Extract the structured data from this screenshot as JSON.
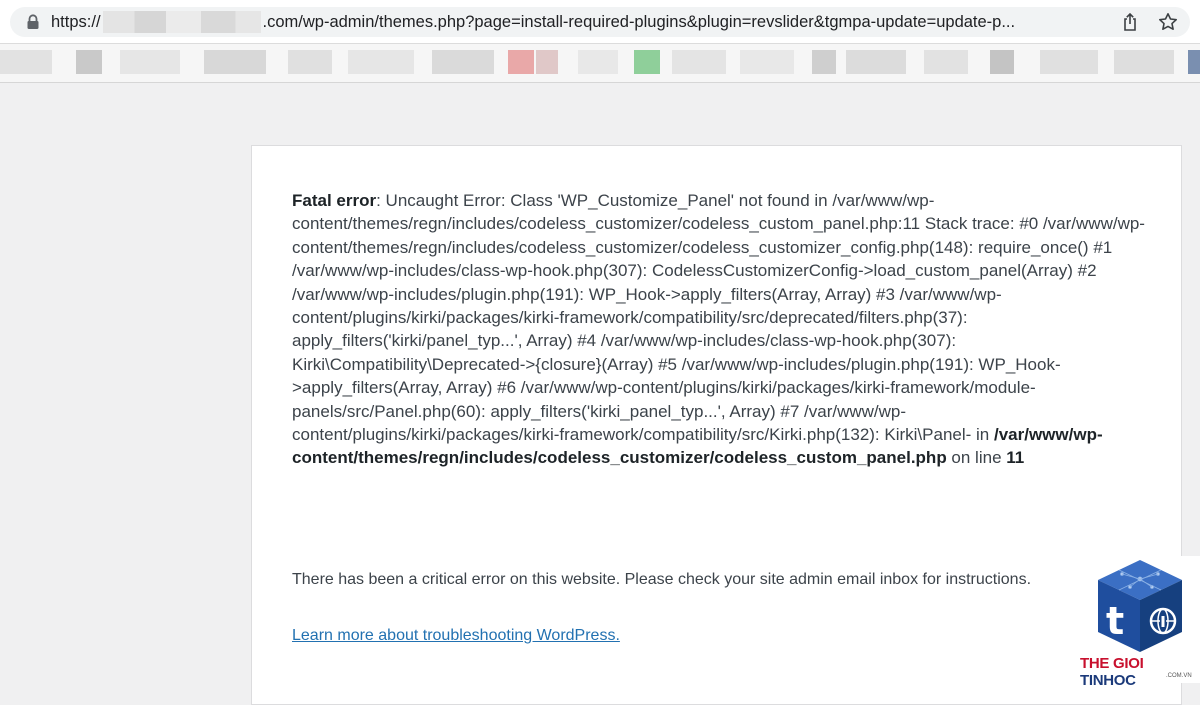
{
  "browser": {
    "url_prefix": "https://",
    "url_suffix": ".com/wp-admin/themes.php?page=install-required-plugins&plugin=revslider&tgmpa-update=update-p...",
    "icons": {
      "lock": "lock-icon",
      "share": "share-icon",
      "bookmark": "star-icon"
    }
  },
  "error": {
    "label": "Fatal error",
    "message": ": Uncaught Error: Class 'WP_Customize_Panel' not found in /var/www/wp-content/themes/regn/includes/codeless_customizer/codeless_custom_panel.php:11 Stack trace: #0 /var/www/wp-content/themes/regn/includes/codeless_customizer/codeless_customizer_config.php(148): require_once() #1 /var/www/wp-includes/class-wp-hook.php(307): CodelessCustomizerConfig->load_custom_panel(Array) #2 /var/www/wp-includes/plugin.php(191): WP_Hook->apply_filters(Array, Array) #3 /var/www/wp-content/plugins/kirki/packages/kirki-framework/compatibility/src/deprecated/filters.php(37): apply_filters('kirki/panel_typ...', Array) #4 /var/www/wp-includes/class-wp-hook.php(307): Kirki\\Compatibility\\Deprecated->{closure}(Array) #5 /var/www/wp-includes/plugin.php(191): WP_Hook->apply_filters(Array, Array) #6 /var/www/wp-content/plugins/kirki/packages/kirki-framework/module-panels/src/Panel.php(60): apply_filters('kirki_panel_typ...', Array) #7 /var/www/wp-content/plugins/kirki/packages/kirki-framework/compatibility/src/Kirki.php(132): Kirki\\Panel- in ",
    "file": "/var/www/wp-content/themes/regn/includes/codeless_customizer/codeless_custom_panel.php",
    "on_line": " on line ",
    "line": "11",
    "critical_message": "There has been a critical error on this website. Please check your site admin email inbox for instructions.",
    "learn_more_link": "Learn more about troubleshooting WordPress."
  },
  "watermark": {
    "text_part1": "THE GIOI ",
    "text_part2": "TINHOC",
    "sub": ".COM.VN",
    "logo_letter": "t",
    "colors": {
      "red": "#c8102e",
      "blue": "#1b3a7a"
    }
  }
}
